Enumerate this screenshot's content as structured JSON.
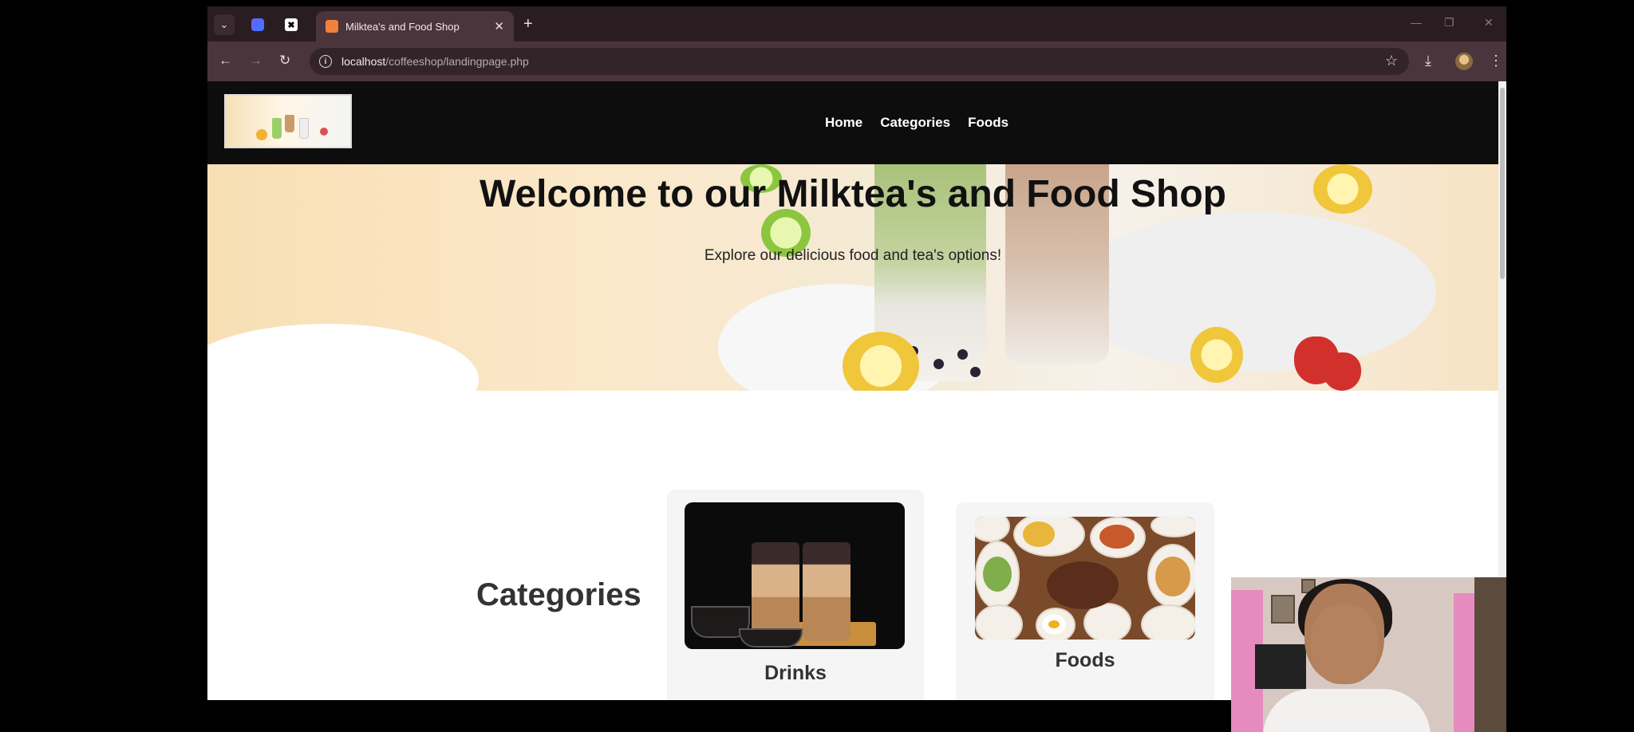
{
  "browser": {
    "tab_title": "Milktea's and Food Shop",
    "new_tab_glyph": "+",
    "url_host": "localhost",
    "url_path": "/coffeeshop/landingpage.php"
  },
  "site": {
    "nav": [
      "Home",
      "Categories",
      "Foods"
    ],
    "hero_title": "Welcome to our Milktea's and Food Shop",
    "hero_subtitle": "Explore our delicious food and tea's options!",
    "categories_heading": "Categories",
    "cards": [
      {
        "label": "Drinks"
      },
      {
        "label": "Foods"
      }
    ]
  },
  "icons": {
    "tab_list": "chevron-down-icon",
    "back": "arrow-left-icon",
    "forward": "arrow-right-icon",
    "reload": "reload-icon",
    "info": "info-icon",
    "bookmark": "star-icon",
    "download": "download-icon",
    "menu": "kebab-menu-icon"
  },
  "colors": {
    "browser_frame": "#2a1d22",
    "site_header": "#0d0d0d",
    "hero_cream": "#f8dfb4",
    "card_bg": "#f5f5f5"
  }
}
